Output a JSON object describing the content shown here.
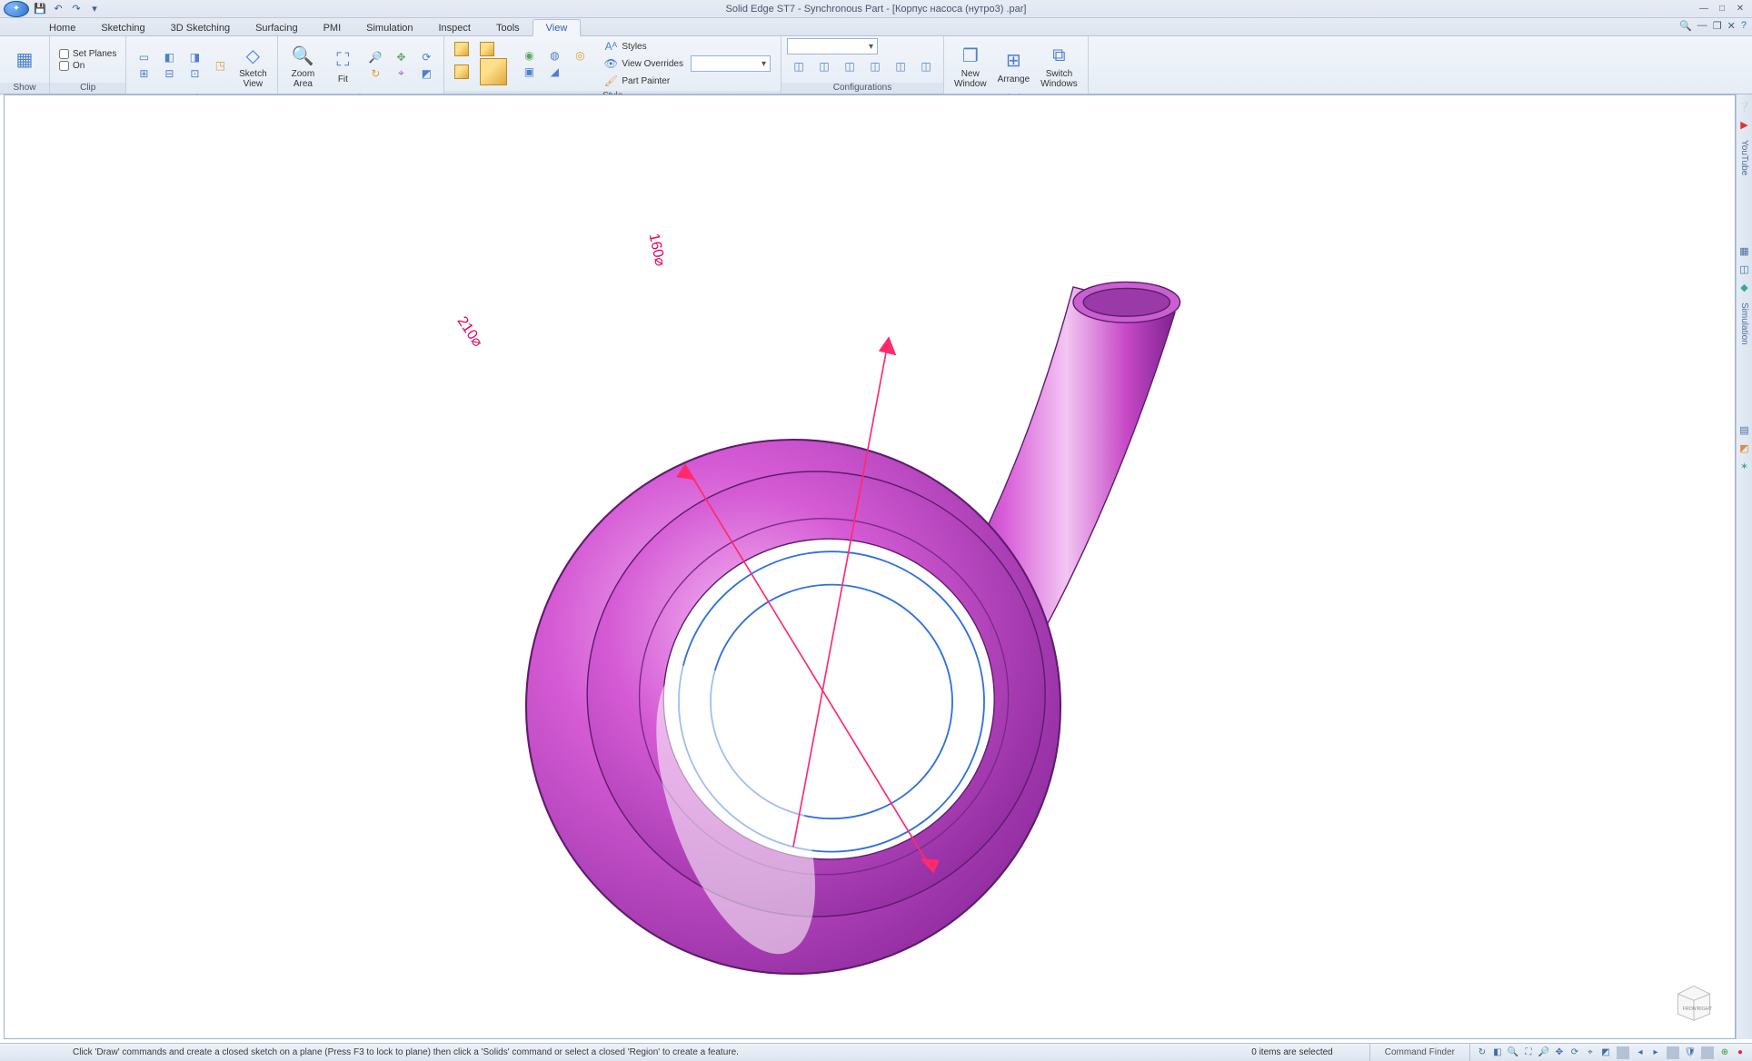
{
  "app": {
    "title": "Solid Edge ST7 - Synchronous Part - [Корпус насоса (нутро3) .par]"
  },
  "tabs": {
    "items": [
      "Home",
      "Sketching",
      "3D Sketching",
      "Surfacing",
      "PMI",
      "Simulation",
      "Inspect",
      "Tools",
      "View"
    ],
    "active": "View"
  },
  "ribbon": {
    "show": {
      "label": "Show"
    },
    "clip": {
      "label": "Clip",
      "set_planes": "Set Planes",
      "on": "On"
    },
    "views": {
      "label": "Views",
      "sketch_view": "Sketch\nView"
    },
    "orient": {
      "label": "Orient",
      "zoom_area": "Zoom\nArea",
      "fit": "Fit"
    },
    "style": {
      "label": "Style",
      "styles": "Styles",
      "view_overrides": "View Overrides",
      "part_painter": "Part Painter"
    },
    "configurations": {
      "label": "Configurations"
    },
    "window": {
      "label": "Window",
      "new_window": "New\nWindow",
      "arrange": "Arrange",
      "switch_windows": "Switch\nWindows"
    }
  },
  "viewport": {
    "dim1": "210⌀",
    "dim2": "160⌀",
    "cube_front": "FRONT",
    "cube_right": "RIGHT"
  },
  "right_panel": {
    "youtube": "YouTube",
    "simulation": "Simulation"
  },
  "status": {
    "hint": "Click 'Draw' commands and create a closed sketch on a plane (Press F3 to lock to plane) then click a 'Solids' command or select a closed 'Region' to create a feature.",
    "selection": "0 items are selected",
    "command_finder": "Command Finder"
  }
}
